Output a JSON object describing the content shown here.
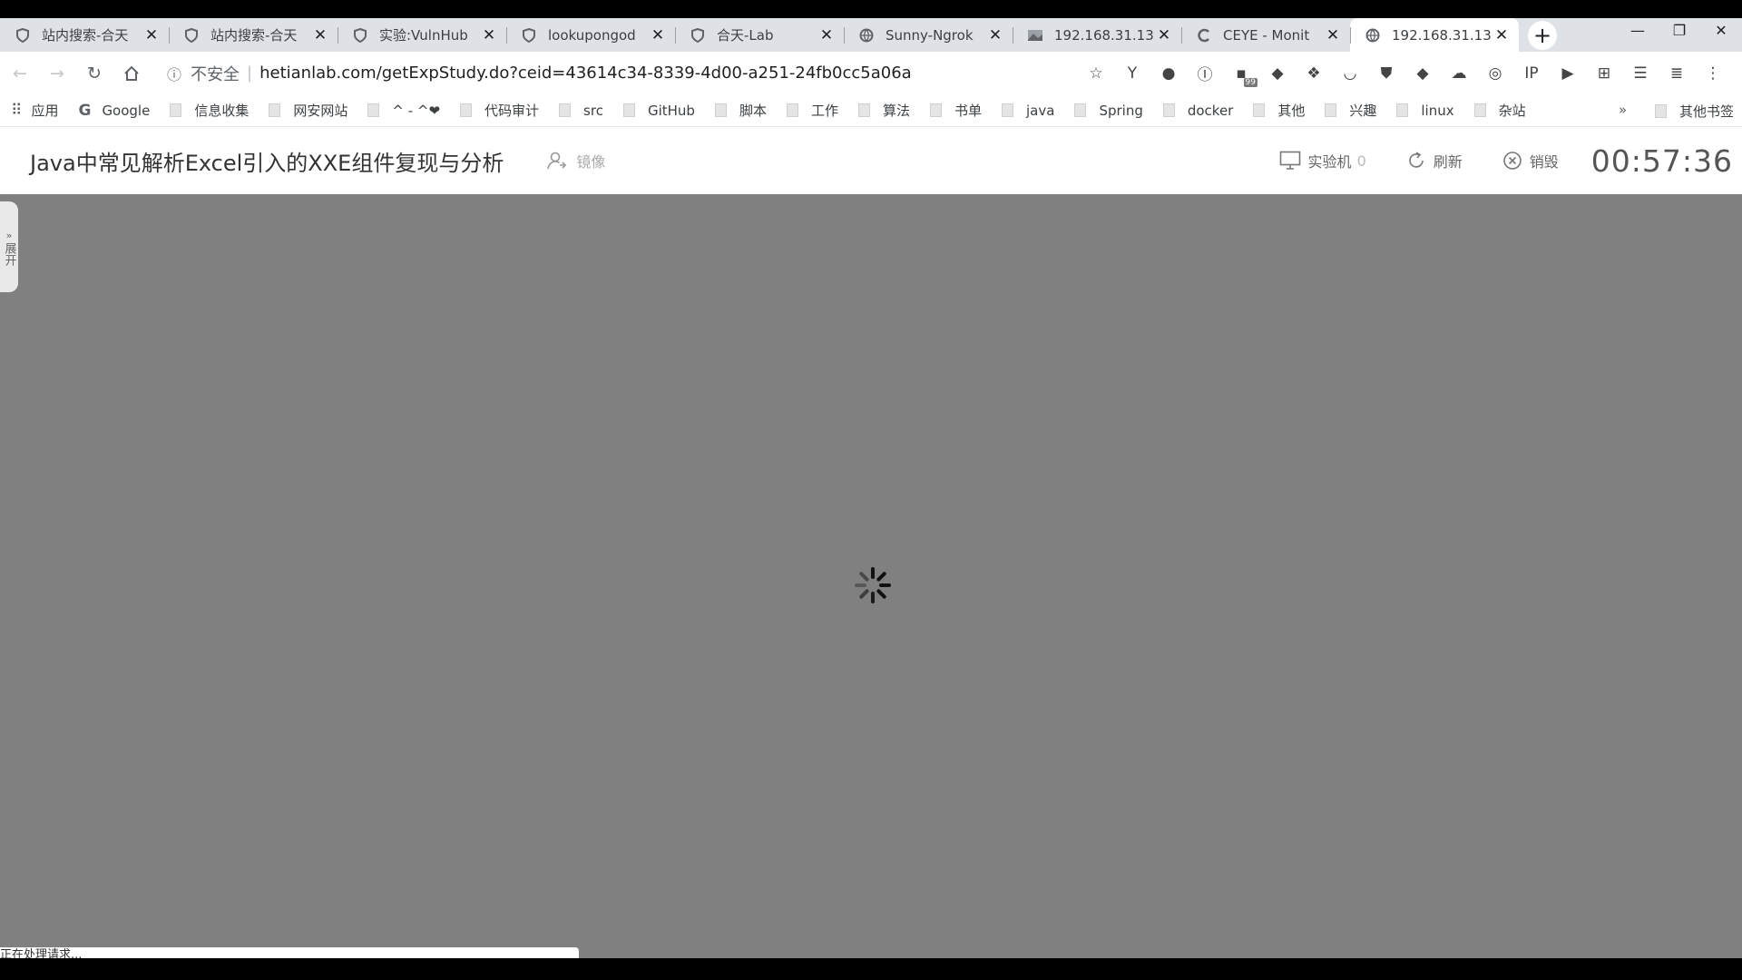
{
  "tabs": [
    {
      "title": "站内搜索-合天",
      "icon": "shield-icon"
    },
    {
      "title": "站内搜索-合天",
      "icon": "shield-icon"
    },
    {
      "title": "实验:VulnHub",
      "icon": "shield-icon"
    },
    {
      "title": "lookupongod",
      "icon": "shield-icon"
    },
    {
      "title": "合天-Lab",
      "icon": "shield-icon"
    },
    {
      "title": "Sunny-Ngrok",
      "icon": "globe-icon"
    },
    {
      "title": "192.168.31.13",
      "icon": "image-icon"
    },
    {
      "title": "CEYE - Monit",
      "icon": "ceye-icon"
    },
    {
      "title": "192.168.31.13",
      "icon": "globe-icon"
    }
  ],
  "omnibox": {
    "insecure_label": "不安全",
    "url": "hetianlab.com/getExpStudy.do?ceid=43614c34-8339-4d00-a251-24fb0cc5a06a"
  },
  "extensions": [
    {
      "icon": "star-icon",
      "glyph": "☆"
    },
    {
      "icon": "y-extension-icon",
      "glyph": "Y"
    },
    {
      "icon": "adblock-icon",
      "glyph": "●"
    },
    {
      "icon": "translate-icon",
      "glyph": "Ⓘ"
    },
    {
      "icon": "counter-extension-icon",
      "glyph": "▪",
      "badge": "99"
    },
    {
      "icon": "cube-icon",
      "glyph": "◆"
    },
    {
      "icon": "flame-icon",
      "glyph": "❖"
    },
    {
      "icon": "pocket-icon",
      "glyph": "◡"
    },
    {
      "icon": "shield-ext-icon",
      "glyph": "⛊"
    },
    {
      "icon": "diamond-icon",
      "glyph": "◆"
    },
    {
      "icon": "cloud-icon",
      "glyph": "☁"
    },
    {
      "icon": "wappalyzer-icon",
      "glyph": "◎"
    },
    {
      "icon": "ip-icon",
      "glyph": "IP"
    },
    {
      "icon": "play-icon",
      "glyph": "▶"
    },
    {
      "icon": "apps-ext-icon",
      "glyph": "⊞"
    },
    {
      "icon": "menu-ext-icon",
      "glyph": "☰"
    },
    {
      "icon": "list-ext-icon",
      "glyph": "≣"
    },
    {
      "icon": "more-vert-icon",
      "glyph": "⋮"
    }
  ],
  "bookmarks": {
    "apps_label": "应用",
    "google_label": "Google",
    "folders": [
      "信息收集",
      "网安网站",
      "^ - ^❤",
      "代码审计",
      "src",
      "GitHub",
      "脚本",
      "工作",
      "算法",
      "书单",
      "java",
      "Spring",
      "docker",
      "其他",
      "兴趣",
      "linux",
      "杂站"
    ],
    "more": "»",
    "other": "其他书签"
  },
  "page": {
    "course_title": "Java中常见解析Excel引入的XXE组件复现与分析",
    "mirror_label": "镜像",
    "machine_label": "实验机",
    "machine_count": "0",
    "refresh_label": "刷新",
    "destroy_label": "销毁",
    "countdown": "00:57:36",
    "side_toggle": "展开",
    "status_text": "正在处理请求..."
  },
  "colors": {
    "main_bg": "#808080",
    "tabstrip_bg": "#dee1e6"
  }
}
